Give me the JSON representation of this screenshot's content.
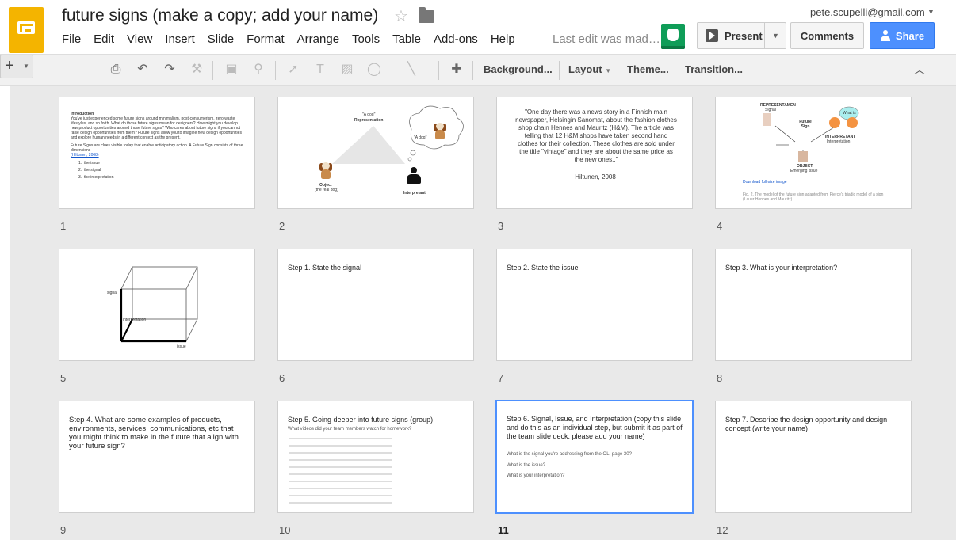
{
  "header": {
    "doc_title": "future signs (make a copy; add your name)",
    "last_edit": "Last edit was mad…",
    "user_email": "pete.scupelli@gmail.com",
    "present_label": "Present",
    "comments_label": "Comments",
    "share_label": "Share"
  },
  "menu": [
    "File",
    "Edit",
    "View",
    "Insert",
    "Slide",
    "Format",
    "Arrange",
    "Tools",
    "Table",
    "Add-ons",
    "Help"
  ],
  "toolbar": {
    "background_label": "Background...",
    "layout_label": "Layout",
    "theme_label": "Theme...",
    "transition_label": "Transition..."
  },
  "colors": {
    "accent": "#4d90fe",
    "logo": "#f4b400",
    "grid_bg": "#e9e9e9"
  },
  "slides": [
    {
      "number": "1",
      "heading": "Introduction",
      "body": "You've just experienced some future signs around minimalism, post-consumerism, zero waste lifestyles, and so forth. What do those future signs mean for designers? How might you develop new product opportunities around those future signs? Who cares about future signs if you cannot raise design opportunities from them? Future signs allow you to imagine new design opportunities and explore human needs in a different context as the present.",
      "body2": "Future Signs are clues visible today that enable anticipatory action. A Future Sign consists of three dimensions",
      "link": "(Hiltunen, 2008)",
      "items": [
        "the issue",
        "the signal",
        "the interpretation"
      ]
    },
    {
      "number": "2",
      "label_top": "\"A dog\"",
      "label_rep": "Representation",
      "label_bubble": "\"A dog\"",
      "label_object": "Object",
      "label_object2": "(the real dog)",
      "label_interpretant": "Interpretant"
    },
    {
      "number": "3",
      "quote": "\"One day there was a news story in a Finnish main newspaper, Helsingin Sanomat, about the fashion clothes shop chain Hennes and Mauritz (H&M). The article was telling that 12 H&M shops have taken second hand clothes for their collection. These clothes are sold under the title \"vintage\" and they are about the same price as the new ones..\"",
      "cite": "Hiltunen, 2008"
    },
    {
      "number": "4",
      "label_rep": "REPRESENTAMEN",
      "label_signal": "Signal",
      "label_future": "Future Sign",
      "label_interp": "INTERPRETANT",
      "label_interp2": "Interpretation",
      "label_object": "OBJECT",
      "label_issue": "Emerging issue",
      "label_what": "What is",
      "link": "Download full-size image",
      "caption": "Fig. 2. The model of the future sign adapted from Pierce's triadic model of a sign (Lauer Hennes and Mauritz)."
    },
    {
      "number": "5",
      "label_signal": "signal",
      "label_interpretation": "interpretation",
      "label_issue": "issue"
    },
    {
      "number": "6",
      "title": "Step 1. State the signal"
    },
    {
      "number": "7",
      "title": "Step 2. State the issue"
    },
    {
      "number": "8",
      "title": "Step 3. What is your interpretation?"
    },
    {
      "number": "9",
      "title": "Step 4. What are some examples of products, environments, services, communications, etc that you might think to make in the future that align with your future sign?"
    },
    {
      "number": "10",
      "title": "Step 5. Going deeper into future signs (group)",
      "subtitle": "What videos did your team members watch for homework?"
    },
    {
      "number": "11",
      "title": "Step 6. Signal, Issue, and Interpretation (copy this slide and do this as an individual step, but submit it as part of the team slide deck. please add your name)",
      "q1": "What is the signal you're addressing from the OLI page 30?",
      "q2": "What is the issue?",
      "q3": "What is your interpretation?"
    },
    {
      "number": "12",
      "title": "Step 7. Describe the design opportunity and design concept (write your name)"
    }
  ]
}
